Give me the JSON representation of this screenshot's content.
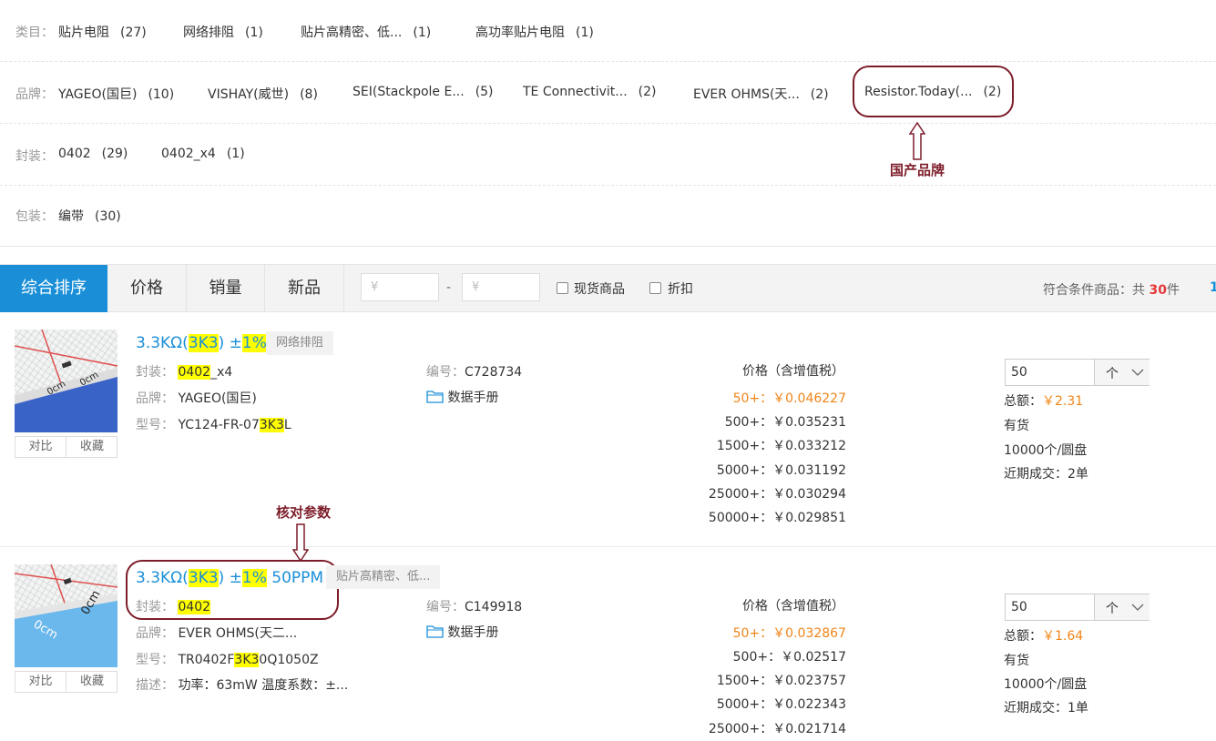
{
  "filters": {
    "category": {
      "label": "类目：",
      "items": [
        {
          "name": "贴片电阻",
          "count": "(27)"
        },
        {
          "name": "网络排阻",
          "count": "(1)"
        },
        {
          "name": "贴片高精密、低...",
          "count": "(1)"
        },
        {
          "name": "高功率贴片电阻",
          "count": "(1)"
        }
      ]
    },
    "brand": {
      "label": "品牌：",
      "items": [
        {
          "name": "YAGEO(国巨)",
          "count": "(10)"
        },
        {
          "name": "VISHAY(威世)",
          "count": "(8)"
        },
        {
          "name": "SEI(Stackpole E...",
          "count": "(5)"
        },
        {
          "name": "TE Connectivit...",
          "count": "(2)"
        },
        {
          "name": "EVER OHMS(天...",
          "count": "(2)"
        },
        {
          "name": "Resistor.Today(...",
          "count": "(2)"
        }
      ]
    },
    "package": {
      "label": "封装：",
      "items": [
        {
          "name": "0402",
          "count": "(29)"
        },
        {
          "name": "0402_x4",
          "count": "(1)"
        }
      ]
    },
    "packing": {
      "label": "包装：",
      "items": [
        {
          "name": "编带",
          "count": "(30)"
        }
      ]
    }
  },
  "annotations": {
    "domestic_brand": "国产品牌",
    "check_params": "核对参数"
  },
  "sortbar": {
    "tabs": [
      "综合排序",
      "价格",
      "销量",
      "新品"
    ],
    "price_from_placeholder": "¥",
    "price_to_placeholder": "¥",
    "dash": "-",
    "in_stock_label": "现货商品",
    "discount_label": "折扣",
    "total_prefix": "符合条件商品：共 ",
    "total_count": "30",
    "total_suffix": "件",
    "page_number": "1"
  },
  "products": [
    {
      "title_a": "3.3KΩ(",
      "title_hl1": "3K3",
      "title_b": ") ±",
      "title_hl2": "1%",
      "title_c": "",
      "tag": "网络排阻",
      "package_label": "封装：",
      "package_hl": "0402",
      "package_rest": "_x4",
      "brand_label": "品牌：",
      "brand": "YAGEO(国巨)",
      "model_label": "型号：",
      "model_a": "YC124-FR-07",
      "model_hl": "3K3",
      "model_b": "L",
      "desc_label": "",
      "desc": "",
      "code_label": "编号：",
      "code": "C728734",
      "datasheet": "数据手册",
      "price_header": "价格（含增值税）",
      "prices": [
        "50+：￥0.046227",
        "500+：￥0.035231",
        "1500+：￥0.033212",
        "5000+：￥0.031192",
        "25000+：￥0.030294",
        "50000+：￥0.029851"
      ],
      "qty": "50",
      "unit": "个",
      "total_label": "总额：",
      "total": "￥2.31",
      "stock": "有货",
      "reel": "10000个/圆盘",
      "recent": "近期成交：2单",
      "compare": "对比",
      "favorite": "收藏"
    },
    {
      "title_a": "3.3KΩ(",
      "title_hl1": "3K3",
      "title_b": ") ±",
      "title_hl2": "1%",
      "title_c": " 50PPM",
      "tag": "贴片高精密、低...",
      "package_label": "封装：",
      "package_hl": "0402",
      "package_rest": "",
      "brand_label": "品牌：",
      "brand": "EVER OHMS(天二...",
      "model_label": "型号：",
      "model_a": "TR0402F",
      "model_hl": "3K3",
      "model_b": "0Q1050Z",
      "desc_label": "描述：",
      "desc": "功率：63mW 温度系数：±...",
      "code_label": "编号：",
      "code": "C149918",
      "datasheet": "数据手册",
      "price_header": "价格（含增值税）",
      "prices": [
        "50+：￥0.032867",
        "500+：￥0.02517",
        "1500+：￥0.023757",
        "5000+：￥0.022343",
        "25000+：￥0.021714"
      ],
      "qty": "50",
      "unit": "个",
      "total_label": "总额：",
      "total": "￥1.64",
      "stock": "有货",
      "reel": "10000个/圆盘",
      "recent": "近期成交：1单",
      "compare": "对比",
      "favorite": "收藏"
    }
  ],
  "colors": {
    "accent": "#1a8fd8",
    "annotation": "#7d1d2a",
    "price_highlight": "#f08519",
    "search_highlight": "#ffff00"
  }
}
